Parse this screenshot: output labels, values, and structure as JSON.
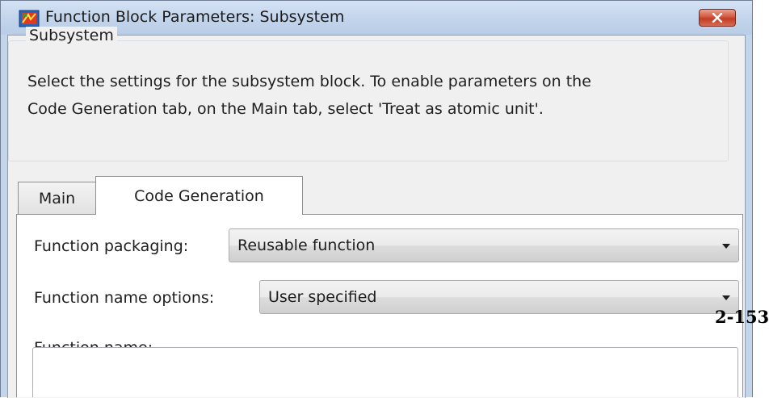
{
  "window": {
    "title": "Function Block Parameters: Subsystem",
    "icon": "simulink-block-icon",
    "close_icon": "close-icon"
  },
  "group": {
    "label": "Subsystem",
    "description_lines": [
      "Select the settings for the subsystem block. To enable parameters on the",
      "Code Generation tab, on the Main tab, select 'Treat as atomic unit'."
    ]
  },
  "tabs": [
    {
      "label": "Main",
      "selected": false
    },
    {
      "label": "Code Generation",
      "selected": true
    }
  ],
  "fields": {
    "function_packaging": {
      "label": "Function packaging:",
      "value": "Reusable function"
    },
    "function_name_options": {
      "label": "Function name options:",
      "value": "User specified"
    },
    "function_name": {
      "label": "Function name:",
      "value": ""
    }
  },
  "page_number": "2-153",
  "colors": {
    "title_bar": "#c4d5ea",
    "close_button": "#c94a30",
    "dialog_body": "#f0f0f0",
    "tab_panel": "#ffffff"
  }
}
